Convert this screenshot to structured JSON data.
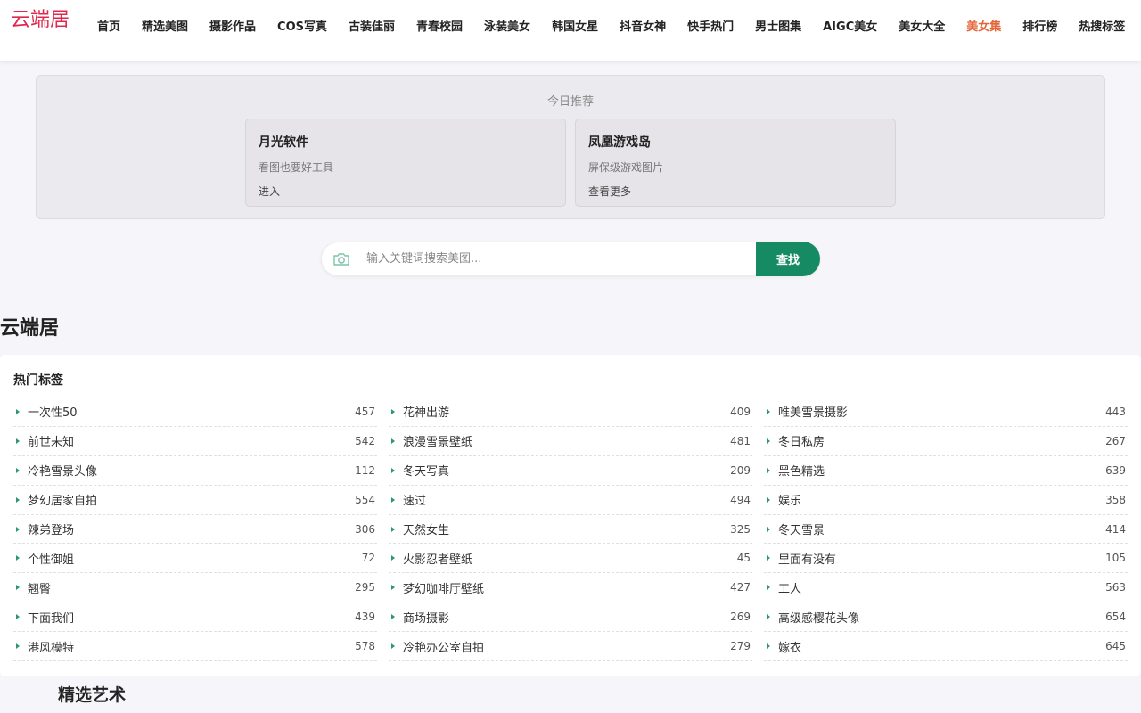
{
  "header": {
    "logo": "云端居",
    "nav": [
      {
        "label": "首页"
      },
      {
        "label": "精选美图"
      },
      {
        "label": "摄影作品"
      },
      {
        "label": "COS写真"
      },
      {
        "label": "古装佳丽"
      },
      {
        "label": "青春校园"
      },
      {
        "label": "泳装美女"
      },
      {
        "label": "韩国女星"
      },
      {
        "label": "抖音女神"
      },
      {
        "label": "快手热门"
      },
      {
        "label": "男士图集"
      },
      {
        "label": "AIGC美女"
      },
      {
        "label": "美女大全"
      },
      {
        "label": "美女集",
        "active": true
      },
      {
        "label": "排行榜"
      },
      {
        "label": "热搜标签"
      }
    ]
  },
  "recommend": {
    "title": "— 今日推荐 —",
    "cards": [
      {
        "title": "月光软件",
        "desc": "看图也要好工具",
        "link": "进入"
      },
      {
        "title": "凤凰游戏岛",
        "desc": "屏保级游戏图片",
        "link": "查看更多"
      }
    ]
  },
  "search": {
    "placeholder": "输入关键词搜索美图...",
    "button": "查找"
  },
  "section_title": "云端居",
  "tags": {
    "title": "热门标签",
    "columns": [
      [
        {
          "name": "一次性50",
          "count": "457"
        },
        {
          "name": "前世未知",
          "count": "542"
        },
        {
          "name": "冷艳雪景头像",
          "count": "112"
        },
        {
          "name": "梦幻居家自拍",
          "count": "554"
        },
        {
          "name": "辣弟登场",
          "count": "306"
        },
        {
          "name": "个性御姐",
          "count": "72"
        },
        {
          "name": "翘臀",
          "count": "295"
        },
        {
          "name": "下面我们",
          "count": "439"
        },
        {
          "name": "港风模特",
          "count": "578"
        }
      ],
      [
        {
          "name": "花神出游",
          "count": "409"
        },
        {
          "name": "浪漫雪景壁纸",
          "count": "481"
        },
        {
          "name": "冬天写真",
          "count": "209"
        },
        {
          "name": "速过",
          "count": "494"
        },
        {
          "name": "天然女生",
          "count": "325"
        },
        {
          "name": "火影忍者壁纸",
          "count": "45"
        },
        {
          "name": "梦幻咖啡厅壁纸",
          "count": "427"
        },
        {
          "name": "商场摄影",
          "count": "269"
        },
        {
          "name": "冷艳办公室自拍",
          "count": "279"
        }
      ],
      [
        {
          "name": "唯美雪景摄影",
          "count": "443"
        },
        {
          "name": "冬日私房",
          "count": "267"
        },
        {
          "name": "黑色精选",
          "count": "639"
        },
        {
          "name": "娱乐",
          "count": "358"
        },
        {
          "name": "冬天雪景",
          "count": "414"
        },
        {
          "name": "里面有没有",
          "count": "105"
        },
        {
          "name": "工人",
          "count": "563"
        },
        {
          "name": "高级感樱花头像",
          "count": "654"
        },
        {
          "name": "嫁衣",
          "count": "645"
        }
      ]
    ]
  },
  "featured_title": "精选艺术",
  "colors": {
    "logo": "#e0284f",
    "nav_active": "#e3663a",
    "accent_green": "#168a62"
  }
}
